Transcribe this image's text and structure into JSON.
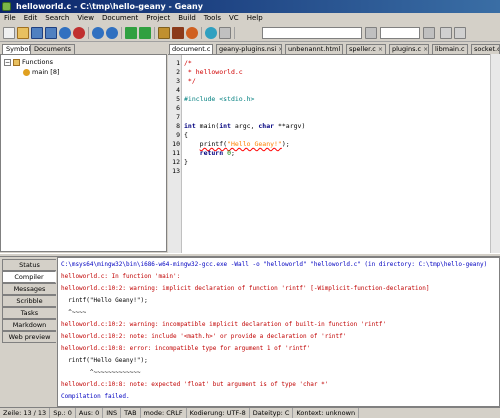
{
  "window": {
    "title": "helloworld.c - C:\\tmp\\hello-geany - Geany"
  },
  "menu": [
    "File",
    "Edit",
    "Search",
    "View",
    "Document",
    "Project",
    "Build",
    "Tools",
    "VC",
    "Help"
  ],
  "sidebar": {
    "tabs": [
      "Symbols",
      "Documents"
    ],
    "active_tab": "Symbols",
    "tree": [
      {
        "label": "Functions",
        "icon": "folder-icon",
        "expanded": true
      },
      {
        "label": "main [8]",
        "icon": "function-icon"
      }
    ]
  },
  "doc_tabs": [
    {
      "label": "document.c",
      "active": false
    },
    {
      "label": "geany-plugins.nsi",
      "active": false
    },
    {
      "label": "unbenannt.html",
      "active": false
    },
    {
      "label": "speller.c",
      "active": false
    },
    {
      "label": "plugins.c",
      "active": false
    },
    {
      "label": "libmain.c",
      "active": false
    },
    {
      "label": "socket.c",
      "active": false
    }
  ],
  "editor": {
    "line_numbers": [
      "1",
      "2",
      "3",
      "4",
      "5",
      "6",
      "7",
      "8",
      "9",
      "10",
      "11",
      "12",
      "13"
    ],
    "lines": [
      {
        "parts": [
          {
            "t": "/*",
            "c": "c-comment"
          }
        ]
      },
      {
        "parts": [
          {
            "t": " * helloworld.c",
            "c": "c-comment"
          }
        ]
      },
      {
        "parts": [
          {
            "t": " */",
            "c": "c-comment"
          }
        ]
      },
      {
        "parts": []
      },
      {
        "parts": [
          {
            "t": "#include <stdio.h>",
            "c": "c-pre"
          }
        ]
      },
      {
        "parts": []
      },
      {
        "parts": []
      },
      {
        "parts": [
          {
            "t": "int",
            "c": "c-kw"
          },
          {
            "t": " main(",
            "c": ""
          },
          {
            "t": "int",
            "c": "c-kw"
          },
          {
            "t": " argc, ",
            "c": ""
          },
          {
            "t": "char",
            "c": "c-kw"
          },
          {
            "t": " **argv)",
            "c": ""
          }
        ]
      },
      {
        "parts": [
          {
            "t": "{",
            "c": ""
          }
        ]
      },
      {
        "parts": [
          {
            "t": "    ",
            "c": ""
          },
          {
            "t": "printf(",
            "c": "c-err"
          },
          {
            "t": "\"Hello Geany!\"",
            "c": "c-str c-err"
          },
          {
            "t": ");",
            "c": ""
          }
        ]
      },
      {
        "parts": [
          {
            "t": "    ",
            "c": ""
          },
          {
            "t": "return",
            "c": "c-kw"
          },
          {
            "t": " ",
            "c": ""
          },
          {
            "t": "0",
            "c": "c-num"
          },
          {
            "t": ";",
            "c": ""
          }
        ]
      },
      {
        "parts": [
          {
            "t": "}",
            "c": ""
          }
        ]
      },
      {
        "parts": []
      }
    ]
  },
  "message_tabs": [
    "Status",
    "Compiler",
    "Messages",
    "Scribble",
    "Tasks",
    "Markdown Preview",
    "Web preview"
  ],
  "active_message_tab": "Compiler",
  "compiler_output": [
    {
      "text": "C:\\msys64\\mingw32\\bin\\i686-w64-mingw32-gcc.exe -Wall -o \"helloworld\" \"helloworld.c\" (in directory: C:\\tmp\\hello-geany)",
      "c": "c-blue"
    },
    {
      "text": "helloworld.c: In function 'main':",
      "c": "c-red"
    },
    {
      "text": "helloworld.c:10:2: warning: implicit declaration of function 'rintf' [-Wimplicit-function-declaration]",
      "c": "c-red"
    },
    {
      "text": "  rintf(\"Hello Geany!\");",
      "c": "c-black"
    },
    {
      "text": "  ^~~~~",
      "c": "c-black"
    },
    {
      "text": "helloworld.c:10:2: warning: incompatible implicit declaration of built-in function 'rintf'",
      "c": "c-red"
    },
    {
      "text": "helloworld.c:10:2: note: include '<math.h>' or provide a declaration of 'rintf'",
      "c": "c-red"
    },
    {
      "text": "helloworld.c:10:8: error: incompatible type for argument 1 of 'rintf'",
      "c": "c-red"
    },
    {
      "text": "  rintf(\"Hello Geany!\");",
      "c": "c-black"
    },
    {
      "text": "        ^~~~~~~~~~~~~~",
      "c": "c-black"
    },
    {
      "text": "helloworld.c:10:8: note: expected 'float' but argument is of type 'char *'",
      "c": "c-red"
    },
    {
      "text": "Compilation failed.",
      "c": "c-blue"
    }
  ],
  "statusbar": {
    "line": "Zeile: 13 / 13",
    "col": "Sp.: 0",
    "sel": "Aus: 0",
    "ins": "INS",
    "tab": "TAB",
    "mode": "mode: CRLF",
    "encoding": "Kodierung: UTF-8",
    "filetype": "Dateityp: C",
    "context": "Kontext: unknown"
  },
  "colors": {
    "title_bg": "#0a246a",
    "chrome": "#d4d0c8",
    "comment": "#d00000",
    "keyword": "#00007f",
    "string": "#ff8000",
    "error_text": "#c00000",
    "info_text": "#0000c0"
  }
}
